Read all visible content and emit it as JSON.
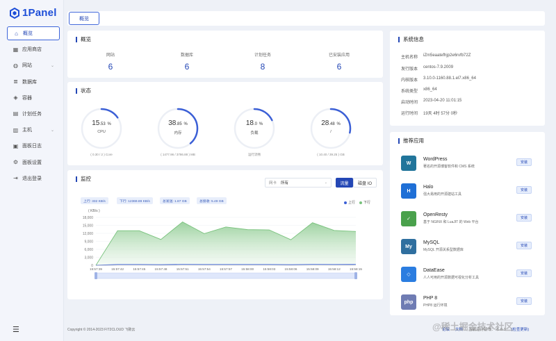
{
  "app": {
    "logo": "1Panel"
  },
  "sidebar": {
    "items": [
      {
        "label": "概览",
        "icon": "home-icon",
        "glyph": "⌂"
      },
      {
        "label": "应用商店",
        "icon": "grid-icon",
        "glyph": "▦"
      },
      {
        "label": "网站",
        "icon": "globe-icon",
        "glyph": "◍"
      },
      {
        "label": "数据库",
        "icon": "database-icon",
        "glyph": "≣"
      },
      {
        "label": "容器",
        "icon": "docker-icon",
        "glyph": "◈"
      },
      {
        "label": "计划任务",
        "icon": "calendar-icon",
        "glyph": "▤"
      },
      {
        "label": "主机",
        "icon": "server-icon",
        "glyph": "▥"
      },
      {
        "label": "面板日志",
        "icon": "log-icon",
        "glyph": "▣"
      },
      {
        "label": "面板设置",
        "icon": "settings-icon",
        "glyph": "⚙"
      },
      {
        "label": "退出登录",
        "icon": "logout-icon",
        "glyph": "⇥"
      }
    ]
  },
  "topbar": {
    "tab": "概览"
  },
  "overview": {
    "title": "概览",
    "items": [
      {
        "label": "网站",
        "value": "6"
      },
      {
        "label": "数据库",
        "value": "6"
      },
      {
        "label": "计划任务",
        "value": "8"
      },
      {
        "label": "已安装应用",
        "value": "6"
      }
    ]
  },
  "status": {
    "title": "状态",
    "gauges": [
      {
        "int": "15",
        "dec": ".53",
        "unit": "%",
        "label": "CPU",
        "sub": "( 0.30 / 2 ) Core",
        "percent": 15.53
      },
      {
        "int": "38",
        "dec": ".85",
        "unit": "%",
        "label": "内存",
        "sub": "( 1477.96 / 3786.88 ) MB",
        "percent": 38.85
      },
      {
        "int": "18",
        "dec": ".0",
        "unit": "%",
        "label": "负载",
        "sub": "运行流畅",
        "percent": 18.0
      },
      {
        "int": "28",
        "dec": ".48",
        "unit": "%",
        "label": "/",
        "sub": "( 10.40 / 39.25 ) GB",
        "percent": 28.48
      }
    ]
  },
  "monitor": {
    "title": "监控",
    "select_label": "网卡",
    "select_value": "所有",
    "tab_traffic": "流量",
    "tab_disk": "磁盘 IO",
    "pills": [
      "上行: 332 KB/s",
      "下行: 12369.89 KB/s",
      "总发送: 1.87 GB",
      "总接收: 5.49 GB"
    ],
    "legend": [
      "上行",
      "下行"
    ]
  },
  "chart_data": {
    "type": "area",
    "ylabel": "( KB/s )",
    "ylim": [
      0,
      18000
    ],
    "yticks": [
      "0",
      "3,000",
      "6,000",
      "9,000",
      "12,000",
      "15,000",
      "18,000"
    ],
    "x": [
      "15:57:39",
      "15:57:42",
      "15:57:45",
      "15:57:48",
      "15:57:51",
      "15:57:54",
      "15:57:57",
      "15:58:00",
      "15:58:03",
      "15:58:06",
      "15:58:09",
      "15:58:12",
      "15:58:15"
    ],
    "series": [
      {
        "name": "下行",
        "color": "#78c27c",
        "values": [
          0,
          13000,
          13000,
          9700,
          16300,
          11900,
          14400,
          13400,
          13300,
          9600,
          16000,
          13100,
          12700
        ]
      },
      {
        "name": "上行",
        "color": "#3b5fd6",
        "values": [
          0,
          300,
          300,
          250,
          350,
          300,
          320,
          300,
          300,
          250,
          340,
          310,
          330
        ]
      }
    ]
  },
  "sysinfo": {
    "title": "系统信息",
    "rows": [
      {
        "k": "主机名称",
        "v": "iZm5eaatefhjp2e6rvfb72Z"
      },
      {
        "k": "发行版本",
        "v": "centos-7.9.2009"
      },
      {
        "k": "内核版本",
        "v": "3.10.0-1160.88.1.el7.x86_64"
      },
      {
        "k": "系统类型",
        "v": "x86_64"
      },
      {
        "k": "启动时间",
        "v": "2023-04-20 11:01:15"
      },
      {
        "k": "运行时间",
        "v": "19天 4时 57分 0秒"
      }
    ]
  },
  "apps": {
    "title": "推荐应用",
    "install_label": "安装",
    "items": [
      {
        "name": "WordPress",
        "desc": "著名的开源博客软件和 CMS 系统",
        "icon": "wordpress-icon",
        "glyph": "W",
        "color": "#21759b"
      },
      {
        "name": "Halo",
        "desc": "强大易用的开源建站工具",
        "icon": "halo-icon",
        "glyph": "H",
        "color": "#1f6fd6"
      },
      {
        "name": "OpenResty",
        "desc": "基于 NGINX 和 LuaJIT 的 Web 平台",
        "icon": "openresty-icon",
        "glyph": "✓",
        "color": "#4aa14c"
      },
      {
        "name": "MySQL",
        "desc": "MySQL 开源关系型数据库",
        "icon": "mysql-icon",
        "glyph": "My",
        "color": "#2f6f9f"
      },
      {
        "name": "DataEase",
        "desc": "人人可用的开源数据可视化分析工具",
        "icon": "dataease-icon",
        "glyph": "◇",
        "color": "#2b7de0"
      },
      {
        "name": "PHP 8",
        "desc": "PHP8 运行环境",
        "icon": "php-icon",
        "glyph": "php",
        "color": "#6f7cb3"
      }
    ]
  },
  "footer": {
    "copyright": "Copyright © 2014-2023 FIT2CLOUD 飞致云",
    "forum": "论坛",
    "docs": "文档",
    "version": "当前运行版本：v1.0.1",
    "update": "(检查更新)"
  },
  "watermark": "@稀土掘金技术社区",
  "colors": {
    "accent": "#2447b5",
    "download": "#78c27c",
    "upload": "#3b5fd6"
  }
}
